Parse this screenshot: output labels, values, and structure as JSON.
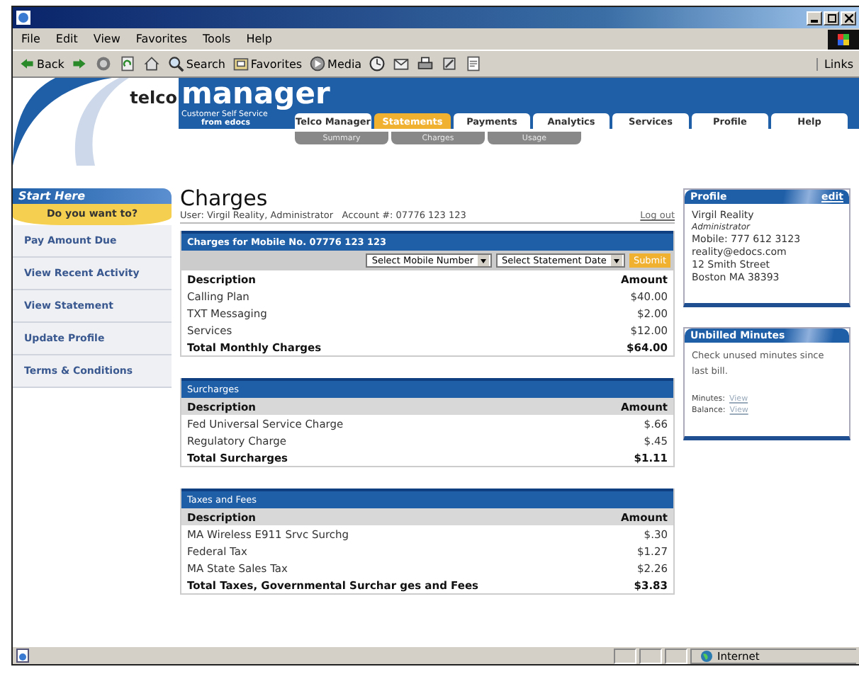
{
  "window": {
    "menu": [
      "File",
      "Edit",
      "View",
      "Favorites",
      "Tools",
      "Help"
    ],
    "toolbar": [
      {
        "kind": "back",
        "label": "Back"
      },
      {
        "kind": "forward"
      },
      {
        "kind": "stop"
      },
      {
        "kind": "refresh"
      },
      {
        "kind": "home"
      },
      {
        "kind": "search",
        "label": "Search"
      },
      {
        "kind": "favorites",
        "label": "Favorites"
      },
      {
        "kind": "media",
        "label": "Media"
      },
      {
        "kind": "history"
      },
      {
        "kind": "mail"
      },
      {
        "kind": "print"
      },
      {
        "kind": "edit"
      },
      {
        "kind": "discuss"
      }
    ],
    "links": "Links"
  },
  "header": {
    "logo_left": "telco",
    "logo_right": "manager",
    "tagline": "Customer Self Service",
    "tagline_by": "from edocs",
    "tabs": [
      {
        "label": "Telco Manager",
        "selected": false
      },
      {
        "label": "Statements",
        "selected": true
      },
      {
        "label": "Payments",
        "selected": false
      },
      {
        "label": "Analytics",
        "selected": false
      },
      {
        "label": "Services",
        "selected": false
      },
      {
        "label": "Profile",
        "selected": false
      },
      {
        "label": "Help",
        "selected": false
      }
    ],
    "subtabs": [
      {
        "label": "Summary",
        "selected": false
      },
      {
        "label": "Charges",
        "selected": false
      },
      {
        "label": "Usage",
        "selected": false
      }
    ]
  },
  "sidebar": {
    "title": "Start Here",
    "prompt": "Do you want to?",
    "items": [
      "Pay Amount Due",
      "View Recent Activity",
      "View Statement",
      "Update Profile",
      "Terms & Conditions"
    ]
  },
  "main": {
    "title": "Charges",
    "user_line": "User: Virgil Reality, Administrator   Account #: 07776 123 123",
    "logout": "Log out",
    "sections": [
      {
        "title": "Charges for Mobile No. 07776 123 123",
        "controls": {
          "mobile_select": "Select Mobile Number",
          "date_select": "Select Statement Date",
          "submit": "Submit"
        },
        "header_shaded": false,
        "columns": [
          "Description",
          "Amount"
        ],
        "rows": [
          {
            "kind": "item",
            "description": "Calling Plan",
            "amount": "$40.00"
          },
          {
            "kind": "item",
            "description": "TXT Messaging",
            "amount": "$2.00"
          },
          {
            "kind": "item",
            "description": "Services",
            "amount": "$12.00"
          },
          {
            "kind": "total",
            "description": "Total Monthly Charges",
            "amount": "$64.00"
          }
        ]
      },
      {
        "title": "Surcharges",
        "header_shaded": true,
        "columns": [
          "Description",
          "Amount"
        ],
        "rows": [
          {
            "kind": "item",
            "description": "Fed Universal Service Charge",
            "amount": "$.66"
          },
          {
            "kind": "item",
            "description": "Regulatory Charge",
            "amount": "$.45"
          },
          {
            "kind": "total",
            "description": "Total Surcharges",
            "amount": "$1.11"
          }
        ]
      },
      {
        "title": "Taxes and Fees",
        "header_shaded": true,
        "columns": [
          "Description",
          "Amount"
        ],
        "rows": [
          {
            "kind": "item",
            "description": "MA Wireless E911 Srvc Surchg",
            "amount": "$.30"
          },
          {
            "kind": "item",
            "description": "Federal Tax",
            "amount": "$1.27"
          },
          {
            "kind": "item",
            "description": "MA State Sales Tax",
            "amount": "$2.26"
          },
          {
            "kind": "total",
            "description": "Total Taxes, Governmental Surchar ges and Fees",
            "amount": "$3.83"
          }
        ]
      }
    ]
  },
  "profile": {
    "title": "Profile",
    "edit": "edit",
    "name": "Virgil Reality",
    "role": "Administrator",
    "lines": [
      "Mobile: 777 612 3123",
      "reality@edocs.com",
      "12 Smith Street",
      "Boston MA 38393"
    ]
  },
  "unbilled": {
    "title": "Unbilled Minutes",
    "text": "Check unused minutes since last bill.",
    "links": [
      {
        "label": "Minutes:",
        "link": "View"
      },
      {
        "label": "Balance:",
        "link": "View"
      }
    ]
  },
  "status_bar": {
    "zone": "Internet"
  }
}
